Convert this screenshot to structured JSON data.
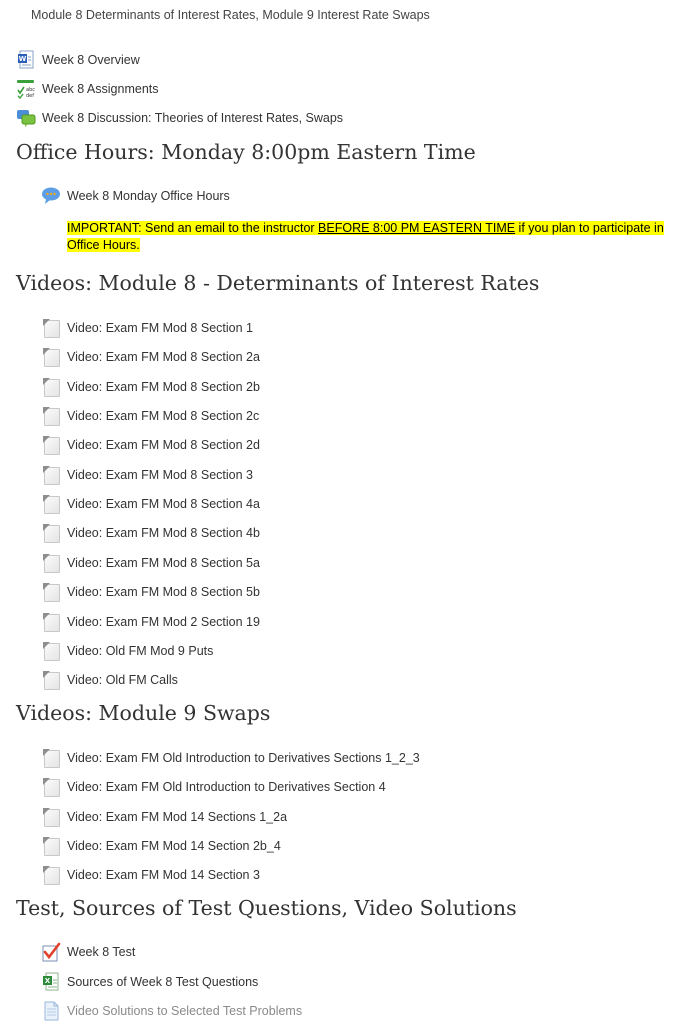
{
  "page_title": "Module 8 Determinants of Interest Rates, Module 9 Interest Rate Swaps",
  "top_items": [
    {
      "label": "Week 8 Overview",
      "icon": "word-document-icon"
    },
    {
      "label": "Week 8 Assignments",
      "icon": "assignment-icon"
    },
    {
      "label": "Week 8 Discussion: Theories of Interest Rates, Swaps",
      "icon": "discussion-forum-icon"
    }
  ],
  "office_hours": {
    "heading": "Office Hours: Monday 8:00pm Eastern Time",
    "item": {
      "label": "Week 8 Monday Office Hours",
      "icon": "chat-bubble-icon"
    },
    "notice_pre": "IMPORTANT: Send an email to the instructor ",
    "notice_emph": "BEFORE 8:00 PM EASTERN TIME",
    "notice_post": " if you plan to participate in Office Hours."
  },
  "videos_mod8": {
    "heading": "Videos: Module 8 - Determinants of Interest Rates",
    "items": [
      "Video: Exam FM Mod 8 Section 1",
      "Video: Exam FM Mod 8 Section 2a",
      "Video: Exam FM Mod 8 Section 2b",
      "Video: Exam FM Mod 8 Section 2c",
      "Video: Exam FM Mod 8 Section 2d",
      "Video: Exam FM Mod 8 Section 3",
      "Video: Exam FM Mod 8 Section 4a",
      "Video: Exam FM Mod 8 Section 4b",
      "Video: Exam FM Mod 8 Section 5a",
      "Video: Exam FM Mod 8 Section 5b",
      "Video: Exam FM Mod 2 Section 19",
      "Video: Old FM Mod 9 Puts",
      "Video: Old FM Calls"
    ]
  },
  "videos_mod9": {
    "heading": "Videos: Module 9 Swaps",
    "items": [
      "Video: Exam FM Old Introduction to Derivatives Sections 1_2_3",
      "Video: Exam FM Old Introduction to Derivatives Section 4",
      "Video: Exam FM Mod 14 Sections 1_2a",
      "Video: Exam FM Mod 14 Section 2b_4",
      "Video: Exam FM Mod 14 Section 3"
    ]
  },
  "test_section": {
    "heading": "Test, Sources of Test Questions, Video Solutions",
    "items": [
      {
        "label": "Week 8 Test",
        "icon": "quiz-checkmark-icon"
      },
      {
        "label": "Sources of Week 8 Test Questions",
        "icon": "excel-document-icon"
      },
      {
        "label": "Video Solutions to Selected Test Problems",
        "icon": "document-page-icon"
      }
    ]
  }
}
